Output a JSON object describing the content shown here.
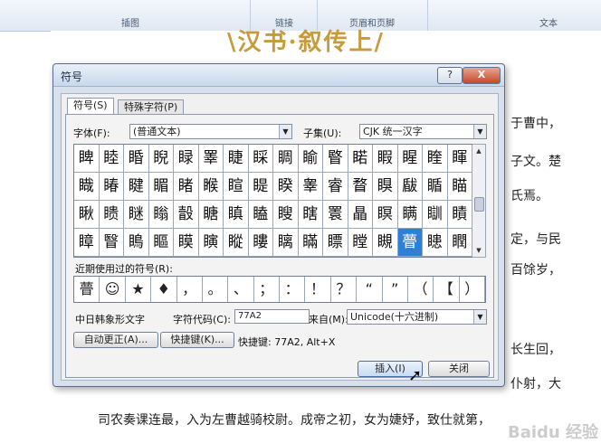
{
  "ribbon": {
    "groups": [
      "插图",
      "链接",
      "页眉和页脚",
      "文本"
    ]
  },
  "document": {
    "title": "\\汉书·叙传上/",
    "right_lines": [
      "于曹中，",
      "子文。楚",
      "氏焉。",
      "定，与民",
      "百馀岁，",
      "长生回，",
      "仆射，大"
    ],
    "bottom_line": "司农奏课连最，入为左曹越骑校尉。成帝之初，女为婕妤，致仕就第，",
    "partial_line": "",
    "watermark": "Baidu 经验"
  },
  "dialog": {
    "title": "符号",
    "help_label": "?",
    "close_label": "X",
    "tabs": [
      "符号(S)",
      "特殊字符(P)"
    ],
    "font_label": "字体(F):",
    "font_value": "(普通文本)",
    "subset_label": "子集(U):",
    "subset_value": "CJK 统一汉字",
    "grid_rows": [
      [
        "睥",
        "睦",
        "睧",
        "睨",
        "睩",
        "睪",
        "睫",
        "睬",
        "睭",
        "睮",
        "睯",
        "睰",
        "睱",
        "睲",
        "睳",
        "睴"
      ],
      [
        "睵",
        "睶",
        "睷",
        "睸",
        "睹",
        "睺",
        "睻",
        "睼",
        "睽",
        "睾",
        "睿",
        "瞀",
        "瞁",
        "瞂",
        "瞃",
        "瞄"
      ],
      [
        "瞅",
        "瞆",
        "瞇",
        "瞈",
        "瞉",
        "瞊",
        "瞋",
        "瞌",
        "瞍",
        "瞎",
        "瞏",
        "瞐",
        "瞑",
        "瞒",
        "瞓",
        "瞔"
      ],
      [
        "瞕",
        "瞖",
        "瞗",
        "瞘",
        "瞙",
        "瞚",
        "瞛",
        "瞜",
        "瞝",
        "瞞",
        "瞟",
        "瞠",
        "瞡",
        "瞢",
        "瞣",
        "瞤"
      ]
    ],
    "selected": "瞢",
    "recent_label": "近期使用过的符号(R):",
    "recent": [
      "瞢",
      "☺",
      "★",
      "♦",
      "，",
      "。",
      "、",
      "；",
      "：",
      "！",
      "？",
      "“",
      "”",
      "（",
      "【",
      "）"
    ],
    "char_name": "中日韩象形文字",
    "code_label": "字符代码(C):",
    "code_value": "77A2",
    "from_label": "来自(M):",
    "from_value": "Unicode(十六进制)",
    "autocorrect_label": "自动更正(A)...",
    "shortcut_label": "快捷键(K)...",
    "shortcut_info": "快捷键: 77A2, Alt+X",
    "insert_label": "插入(I)",
    "close_button_label": "关闭"
  },
  "colors": {
    "selected_cell": "#2f7fd6",
    "dialog_bg": "#d7e1ee",
    "title_color": "#c79a3b"
  }
}
